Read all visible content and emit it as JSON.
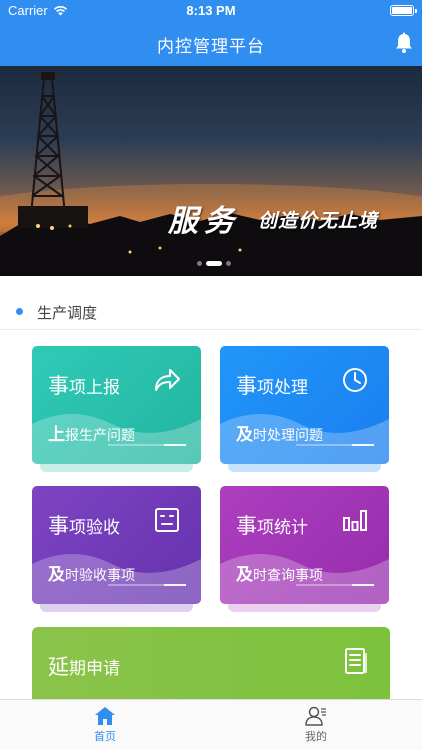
{
  "status_bar": {
    "carrier": "Carrier",
    "time": "8:13 PM"
  },
  "header": {
    "title": "内控管理平台"
  },
  "banner": {
    "slogan_main": "服务",
    "slogan_sub": "创造价无止境",
    "page_count": 3,
    "active_page": 2
  },
  "section": {
    "title": "生产调度"
  },
  "cards": [
    {
      "title_first": "事",
      "title_rest": "项上报",
      "sub_first": "上",
      "sub_rest": "报生产问题",
      "icon": "share-arrow-icon",
      "color_from": "#2dc5b3",
      "color_to": "#23b8a4"
    },
    {
      "title_first": "事",
      "title_rest": "项处理",
      "sub_first": "及",
      "sub_rest": "时处理问题",
      "icon": "clock-icon",
      "color_from": "#1d8cf8",
      "color_to": "#1b7ff0"
    },
    {
      "title_first": "事",
      "title_rest": "项验收",
      "sub_first": "及",
      "sub_rest": "时验收事项",
      "icon": "checklist-box-icon",
      "color_from": "#7b3fbf",
      "color_to": "#6a34b3"
    },
    {
      "title_first": "事",
      "title_rest": "项统计",
      "sub_first": "及",
      "sub_rest": "时查询事项",
      "icon": "bar-chart-icon",
      "color_from": "#a43ab8",
      "color_to": "#9a2fb0"
    }
  ],
  "wide_card": {
    "title_first": "延",
    "title_rest": "期申请",
    "icon": "document-list-icon"
  },
  "tabbar": {
    "home_label": "首页",
    "mine_label": "我的"
  }
}
